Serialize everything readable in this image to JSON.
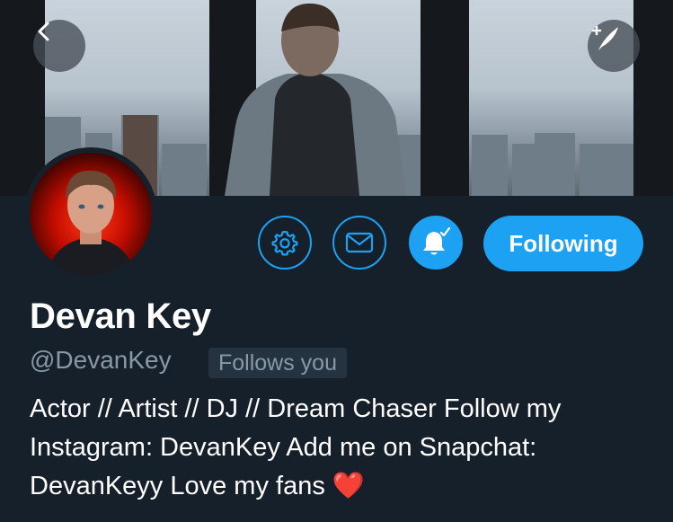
{
  "nav": {
    "back_icon": "chevron-left-icon",
    "compose_icon": "compose-quill-icon"
  },
  "actions": {
    "settings_icon": "gear-icon",
    "message_icon": "envelope-icon",
    "notifications_icon": "bell-check-icon",
    "following_label": "Following"
  },
  "profile": {
    "display_name": "Devan Key",
    "handle": "@DevanKey",
    "follows_you": "Follows you",
    "bio": "Actor // Artist // DJ // Dream Chaser Follow my Instagram: DevanKey Add me on Snapchat: DevanKeyy Love my fans",
    "bio_emoji": "❤️"
  },
  "colors": {
    "background": "#15202b",
    "accent": "#1da1f2",
    "secondary_text": "#8899a6",
    "badge_bg": "#253341"
  }
}
